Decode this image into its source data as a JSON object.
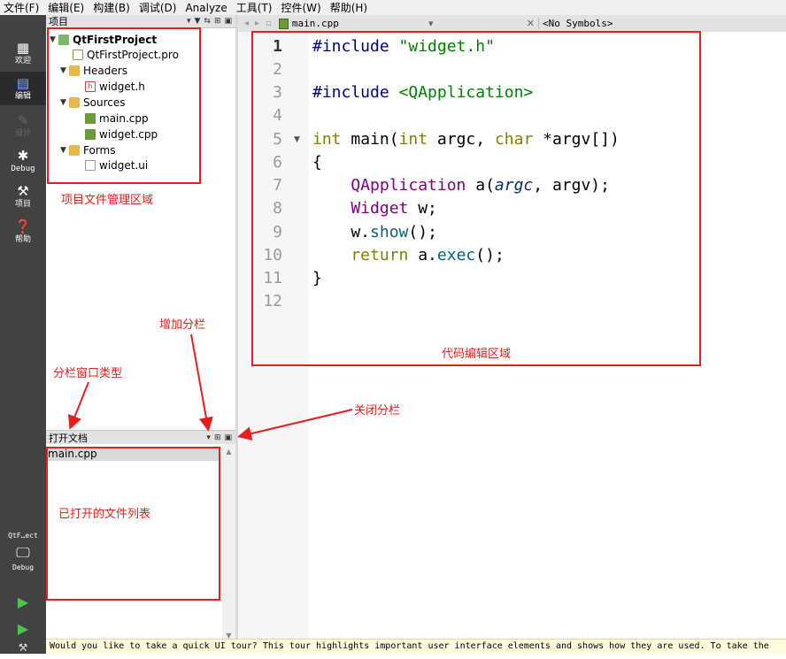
{
  "menu": [
    "文件(F)",
    "编辑(E)",
    "构建(B)",
    "调试(D)",
    "Analyze",
    "工具(T)",
    "控件(W)",
    "帮助(H)"
  ],
  "modes": [
    {
      "label": "欢迎",
      "icon": "grid-icon"
    },
    {
      "label": "编辑",
      "icon": "edit-icon"
    },
    {
      "label": "设计",
      "icon": "pencil-icon"
    },
    {
      "label": "Debug",
      "icon": "bug-icon"
    },
    {
      "label": "项目",
      "icon": "wrench-icon"
    },
    {
      "label": "帮助",
      "icon": "help-icon"
    }
  ],
  "kit": {
    "project": "QtF…ect",
    "build": "Debug"
  },
  "projects_panel": {
    "title": "项目"
  },
  "tree": {
    "project": "QtFirstProject",
    "pro_file": "QtFirstProject.pro",
    "headers": "Headers",
    "header_file": "widget.h",
    "sources": "Sources",
    "source_main": "main.cpp",
    "source_widget": "widget.cpp",
    "forms": "Forms",
    "form_file": "widget.ui"
  },
  "open_docs": {
    "title": "打开文档",
    "items": [
      "main.cpp"
    ]
  },
  "editor": {
    "file": "main.cpp",
    "symbols": "<No Symbols>",
    "line_numbers": [
      "1",
      "2",
      "3",
      "4",
      "5",
      "6",
      "7",
      "8",
      "9",
      "10",
      "11",
      "12"
    ],
    "code": {
      "l1_pp": "#include ",
      "l1_str": "\"widget.h\"",
      "l3_pp": "#include ",
      "l3_str": "<QApplication>",
      "l5_kw": "int ",
      "l5_fn": "main",
      "l5_a": "(",
      "l5_kw2": "int ",
      "l5_b": "argc, ",
      "l5_kw3": "char ",
      "l5_c": "*argv[])",
      "l6": "{",
      "l7_typ": "    QApplication ",
      "l7_a": "a(",
      "l7_param": "argc",
      "l7_b": ", argv);",
      "l8_typ": "    Widget ",
      "l8_a": "w;",
      "l9_a": "    w.",
      "l9_fn": "show",
      "l9_b": "();",
      "l10_kw": "    return ",
      "l10_a": "a.",
      "l10_fn": "exec",
      "l10_b": "();",
      "l11": "}"
    }
  },
  "annotations": {
    "project_area": "项目文件管理区域",
    "code_area": "代码编辑区域",
    "add_split": "增加分栏",
    "split_type": "分栏窗口类型",
    "close_split": "关闭分栏",
    "open_files": "已打开的文件列表"
  },
  "info_bar": "Would you like to take a quick UI tour? This tour highlights important user interface elements and shows how they are used. To take the",
  "colors": {
    "annotation": "#e81d1d",
    "modebar": "#404244",
    "keyword": "#808000",
    "string": "#008000",
    "type": "#800080"
  }
}
